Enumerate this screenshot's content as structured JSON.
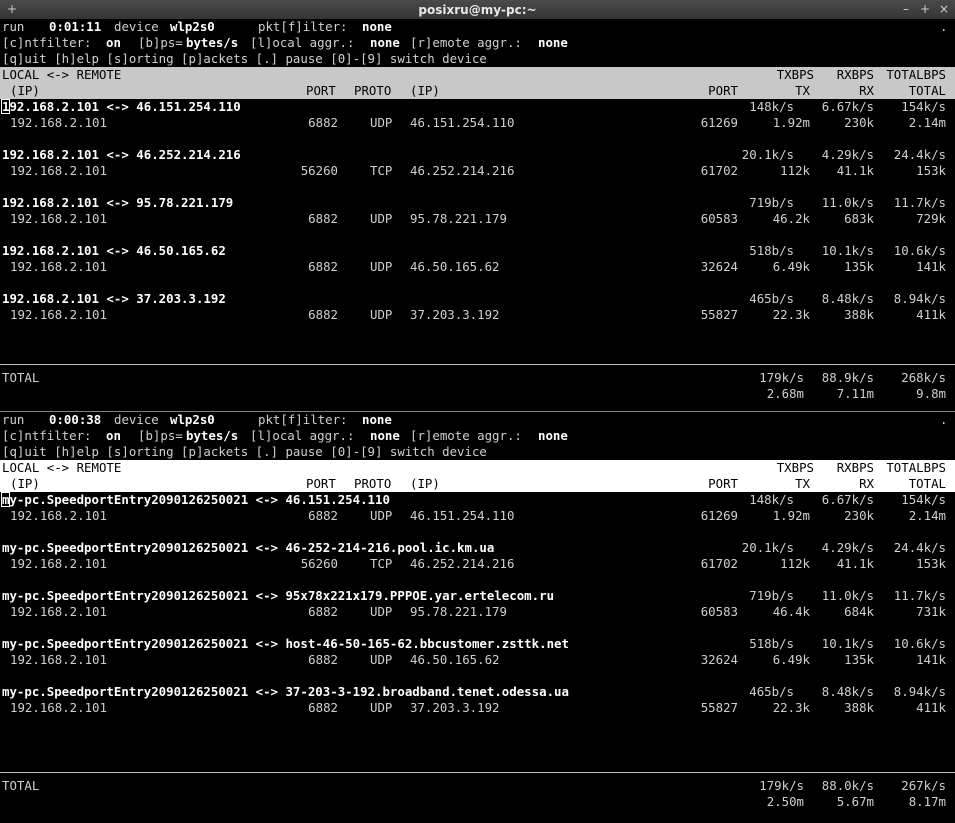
{
  "window": {
    "title": "posixru@my-pc:~",
    "buttons": [
      "+",
      "–",
      "+",
      "×"
    ]
  },
  "panes": [
    {
      "status": {
        "state": "run",
        "elapsed": "0:01:11",
        "device_label": "device",
        "device": "wlp2s0",
        "filter_label": "pkt[f]ilter:",
        "filter": "none",
        "dot": "."
      },
      "options": {
        "cntfilter_label": "[c]ntfilter:",
        "cntfilter": "on",
        "bps_label": "[b]ps=",
        "bps": "bytes/s",
        "local_label": "[l]ocal aggr.:",
        "local": "none",
        "remote_label": "[r]emote aggr.:",
        "remote": "none"
      },
      "help": "[q]uit [h]elp [s]orting [p]ackets [.] pause [0]-[9] switch device",
      "header": {
        "l1": "LOCAL <-> REMOTE",
        "tx": "TXBPS",
        "rx": "RXBPS",
        "total": "TOTALBPS",
        "ip": "(IP)",
        "port": "PORT",
        "proto": "PROTO",
        "rip": "(IP)",
        "rport": "PORT",
        "tx2": "TX",
        "rx2": "RX",
        "total2": "TOTAL"
      },
      "flows": [
        {
          "pair": "192.168.2.101 <-> 46.151.254.110",
          "tx_rate": "148k/s",
          "rx_rate": "6.67k/s",
          "total_rate": "154k/s",
          "local_ip": "192.168.2.101",
          "local_port": "6882",
          "proto": "UDP",
          "remote_ip": "46.151.254.110",
          "remote_port": "61269",
          "tx": "1.92m",
          "rx": "230k",
          "total": "2.14m"
        },
        {
          "pair": "192.168.2.101 <-> 46.252.214.216",
          "tx_rate": "20.1k/s",
          "rx_rate": "4.29k/s",
          "total_rate": "24.4k/s",
          "local_ip": "192.168.2.101",
          "local_port": "56260",
          "proto": "TCP",
          "remote_ip": "46.252.214.216",
          "remote_port": "61702",
          "tx": "112k",
          "rx": "41.1k",
          "total": "153k"
        },
        {
          "pair": "192.168.2.101 <-> 95.78.221.179",
          "tx_rate": "719b/s",
          "rx_rate": "11.0k/s",
          "total_rate": "11.7k/s",
          "local_ip": "192.168.2.101",
          "local_port": "6882",
          "proto": "UDP",
          "remote_ip": "95.78.221.179",
          "remote_port": "60583",
          "tx": "46.2k",
          "rx": "683k",
          "total": "729k"
        },
        {
          "pair": "192.168.2.101 <-> 46.50.165.62",
          "tx_rate": "518b/s",
          "rx_rate": "10.1k/s",
          "total_rate": "10.6k/s",
          "local_ip": "192.168.2.101",
          "local_port": "6882",
          "proto": "UDP",
          "remote_ip": "46.50.165.62",
          "remote_port": "32624",
          "tx": "6.49k",
          "rx": "135k",
          "total": "141k"
        },
        {
          "pair": "192.168.2.101 <-> 37.203.3.192",
          "tx_rate": "465b/s",
          "rx_rate": "8.48k/s",
          "total_rate": "8.94k/s",
          "local_ip": "192.168.2.101",
          "local_port": "6882",
          "proto": "UDP",
          "remote_ip": "37.203.3.192",
          "remote_port": "55827",
          "tx": "22.3k",
          "rx": "388k",
          "total": "411k"
        }
      ],
      "totals": {
        "label": "TOTAL",
        "tx_rate": "179k/s",
        "rx_rate": "88.9k/s",
        "total_rate": "268k/s",
        "tx": "2.68m",
        "rx": "7.11m",
        "total": "9.8m"
      }
    },
    {
      "status": {
        "state": "run",
        "elapsed": "0:00:38",
        "device_label": "device",
        "device": "wlp2s0",
        "filter_label": "pkt[f]ilter:",
        "filter": "none",
        "dot": "."
      },
      "options": {
        "cntfilter_label": "[c]ntfilter:",
        "cntfilter": "on",
        "bps_label": "[b]ps=",
        "bps": "bytes/s",
        "local_label": "[l]ocal aggr.:",
        "local": "none",
        "remote_label": "[r]emote aggr.:",
        "remote": "none"
      },
      "help": "[q]uit [h]elp [s]orting [p]ackets [.] pause [0]-[9] switch device",
      "header": {
        "l1": "LOCAL <-> REMOTE",
        "tx": "TXBPS",
        "rx": "RXBPS",
        "total": "TOTALBPS",
        "ip": "(IP)",
        "port": "PORT",
        "proto": "PROTO",
        "rip": "(IP)",
        "rport": "PORT",
        "tx2": "TX",
        "rx2": "RX",
        "total2": "TOTAL"
      },
      "flows": [
        {
          "pair": "my-pc.SpeedportEntry2090126250021 <-> 46.151.254.110",
          "tx_rate": "148k/s",
          "rx_rate": "6.67k/s",
          "total_rate": "154k/s",
          "local_ip": "192.168.2.101",
          "local_port": "6882",
          "proto": "UDP",
          "remote_ip": "46.151.254.110",
          "remote_port": "61269",
          "tx": "1.92m",
          "rx": "230k",
          "total": "2.14m"
        },
        {
          "pair": "my-pc.SpeedportEntry2090126250021 <-> 46-252-214-216.pool.ic.km.ua",
          "tx_rate": "20.1k/s",
          "rx_rate": "4.29k/s",
          "total_rate": "24.4k/s",
          "local_ip": "192.168.2.101",
          "local_port": "56260",
          "proto": "TCP",
          "remote_ip": "46.252.214.216",
          "remote_port": "61702",
          "tx": "112k",
          "rx": "41.1k",
          "total": "153k"
        },
        {
          "pair": "my-pc.SpeedportEntry2090126250021 <-> 95x78x221x179.PPPOE.yar.ertelecom.ru",
          "tx_rate": "719b/s",
          "rx_rate": "11.0k/s",
          "total_rate": "11.7k/s",
          "local_ip": "192.168.2.101",
          "local_port": "6882",
          "proto": "UDP",
          "remote_ip": "95.78.221.179",
          "remote_port": "60583",
          "tx": "46.4k",
          "rx": "684k",
          "total": "731k"
        },
        {
          "pair": "my-pc.SpeedportEntry2090126250021 <-> host-46-50-165-62.bbcustomer.zsttk.net",
          "tx_rate": "518b/s",
          "rx_rate": "10.1k/s",
          "total_rate": "10.6k/s",
          "local_ip": "192.168.2.101",
          "local_port": "6882",
          "proto": "UDP",
          "remote_ip": "46.50.165.62",
          "remote_port": "32624",
          "tx": "6.49k",
          "rx": "135k",
          "total": "141k"
        },
        {
          "pair": "my-pc.SpeedportEntry2090126250021 <-> 37-203-3-192.broadband.tenet.odessa.ua",
          "tx_rate": "465b/s",
          "rx_rate": "8.48k/s",
          "total_rate": "8.94k/s",
          "local_ip": "192.168.2.101",
          "local_port": "6882",
          "proto": "UDP",
          "remote_ip": "37.203.3.192",
          "remote_port": "55827",
          "tx": "22.3k",
          "rx": "388k",
          "total": "411k"
        }
      ],
      "totals": {
        "label": "TOTAL",
        "tx_rate": "179k/s",
        "rx_rate": "88.0k/s",
        "total_rate": "267k/s",
        "tx": "2.50m",
        "rx": "5.67m",
        "total": "8.17m"
      }
    }
  ]
}
